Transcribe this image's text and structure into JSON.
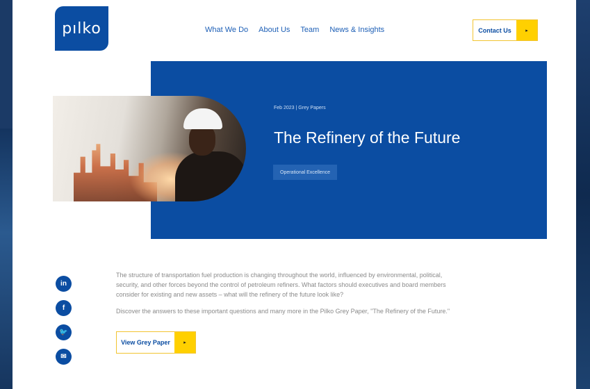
{
  "brand": {
    "logo_text": "pılko",
    "color": "#0b4da2",
    "accent": "#ffd000"
  },
  "nav": {
    "items": [
      {
        "label": "What We Do"
      },
      {
        "label": "About Us"
      },
      {
        "label": "Team"
      },
      {
        "label": "News & Insights"
      }
    ],
    "contact_label": "Contact Us",
    "arrow_icon": "▸"
  },
  "hero": {
    "meta": "Feb 2023  |  Grey Papers",
    "title": "The Refinery of the Future",
    "tag": "Operational Excellence"
  },
  "social": [
    {
      "name": "linkedin-icon",
      "glyph": "in"
    },
    {
      "name": "facebook-icon",
      "glyph": "f"
    },
    {
      "name": "twitter-icon",
      "glyph": "🐦"
    },
    {
      "name": "email-icon",
      "glyph": "✉"
    }
  ],
  "content": {
    "para1": "The structure of transportation fuel production is changing throughout the world, influenced by environmental, political, security, and other forces beyond the control of petroleum refiners. What factors should executives and board members consider for existing and new assets – what will the refinery of the future look like?",
    "para2": "Discover the answers to these important questions and many more in the Pilko Grey Paper, \"The Refinery of the Future.\"",
    "view_button_label": "View Grey Paper"
  }
}
